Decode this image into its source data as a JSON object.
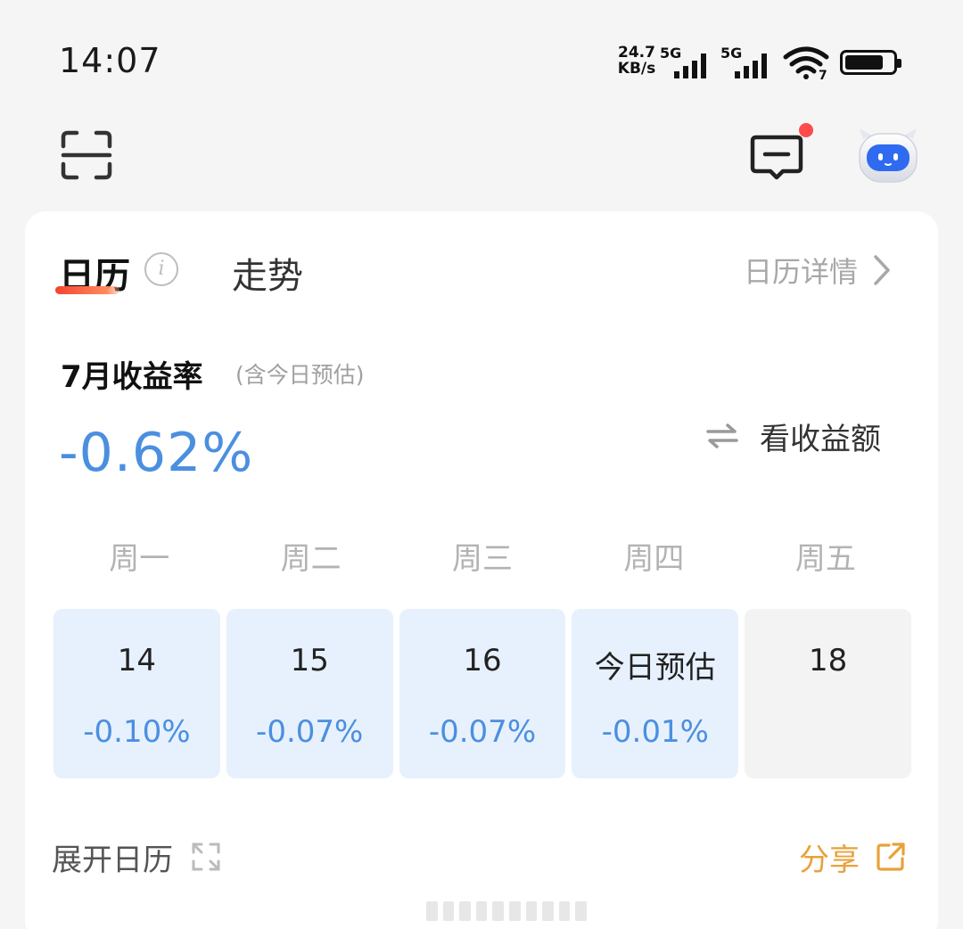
{
  "status_bar": {
    "time": "14:07",
    "net_speed_value": "24.7",
    "net_speed_unit": "KB/s",
    "sim1_tag": "5G",
    "sim2_tag": "5G",
    "wifi_badge": "7",
    "battery_level": 0.8
  },
  "toolbar": {
    "scan_icon": "scan-icon",
    "message_icon": "message-icon",
    "assistant_icon": "robot-assistant-icon",
    "notification_dot_color": "#ff4b4b"
  },
  "card": {
    "tabs": [
      {
        "label": "日历",
        "active": true
      },
      {
        "label": "走势",
        "active": false
      }
    ],
    "info_glyph": "i",
    "detail_link": "日历详情",
    "month_title": "7月收益率",
    "month_note": "(含今日预估)",
    "rate": "-0.62%",
    "switch_label": "看收益额",
    "weekdays": [
      "周一",
      "周二",
      "周三",
      "周四",
      "周五"
    ],
    "days": [
      {
        "label": "14",
        "value": "-0.10%"
      },
      {
        "label": "15",
        "value": "-0.07%"
      },
      {
        "label": "16",
        "value": "-0.07%"
      },
      {
        "label": "今日预估",
        "value": "-0.01%"
      },
      {
        "label": "18",
        "value": ""
      }
    ],
    "expand_label": "展开日历",
    "share_label": "分享"
  },
  "colors": {
    "accent_blue": "#4b8fe0",
    "accent_orange": "#e8a23a",
    "tab_underline": "#f4432f",
    "day_bg": "#e7f1fd",
    "future_day_bg": "#f3f3f3"
  }
}
